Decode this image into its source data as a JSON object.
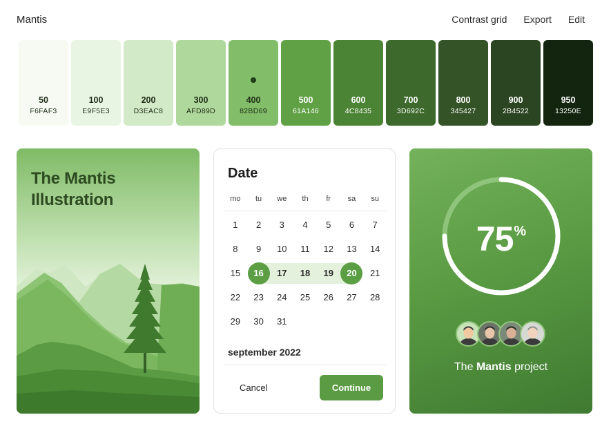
{
  "app": {
    "title": "Mantis",
    "nav": [
      "Contrast grid",
      "Export",
      "Edit"
    ]
  },
  "palette": [
    {
      "shade": "50",
      "hex": "F6FAF3",
      "bg": "#F6FAF3",
      "fg": "#1e2e18"
    },
    {
      "shade": "100",
      "hex": "E9F5E3",
      "bg": "#E9F5E3",
      "fg": "#1e2e18"
    },
    {
      "shade": "200",
      "hex": "D3EAC8",
      "bg": "#D3EAC8",
      "fg": "#1e2e18"
    },
    {
      "shade": "300",
      "hex": "AFD89D",
      "bg": "#AFD89D",
      "fg": "#1e2e18"
    },
    {
      "shade": "400",
      "hex": "82BD69",
      "bg": "#82BD69",
      "fg": "#1e2e18",
      "selected": true
    },
    {
      "shade": "500",
      "hex": "61A146",
      "bg": "#61A146",
      "fg": "#ffffff"
    },
    {
      "shade": "600",
      "hex": "4C8435",
      "bg": "#4C8435",
      "fg": "#ffffff"
    },
    {
      "shade": "700",
      "hex": "3D692C",
      "bg": "#3D692C",
      "fg": "#ffffff"
    },
    {
      "shade": "800",
      "hex": "345427",
      "bg": "#345427",
      "fg": "#ffffff"
    },
    {
      "shade": "900",
      "hex": "2B4522",
      "bg": "#2B4522",
      "fg": "#ffffff"
    },
    {
      "shade": "950",
      "hex": "13250E",
      "bg": "#13250E",
      "fg": "#ffffff"
    }
  ],
  "illustration": {
    "title_line1": "The Mantis",
    "title_line2": "Illustration"
  },
  "date_picker": {
    "title": "Date",
    "weekdays": [
      "mo",
      "tu",
      "we",
      "th",
      "fr",
      "sa",
      "su"
    ],
    "weeks": [
      [
        "1",
        "2",
        "3",
        "4",
        "5",
        "6",
        "7"
      ],
      [
        "8",
        "9",
        "10",
        "11",
        "12",
        "13",
        "14"
      ],
      [
        "15",
        "16",
        "17",
        "18",
        "19",
        "20",
        "21"
      ],
      [
        "22",
        "23",
        "24",
        "25",
        "26",
        "27",
        "28"
      ],
      [
        "29",
        "30",
        "31",
        "",
        "",
        "",
        ""
      ]
    ],
    "range_start": "16",
    "range_end": "20",
    "month_label": "september 2022",
    "cancel_label": "Cancel",
    "continue_label": "Continue"
  },
  "progress": {
    "value": 75,
    "value_label": "75",
    "unit": "%",
    "project_prefix": "The",
    "project_name": "Mantis",
    "project_suffix": "project",
    "avatars": [
      "avatar-1",
      "avatar-2",
      "avatar-3",
      "avatar-4"
    ]
  },
  "colors": {
    "accent": "#5a9b43",
    "range_bg": "#e4f1dd"
  }
}
